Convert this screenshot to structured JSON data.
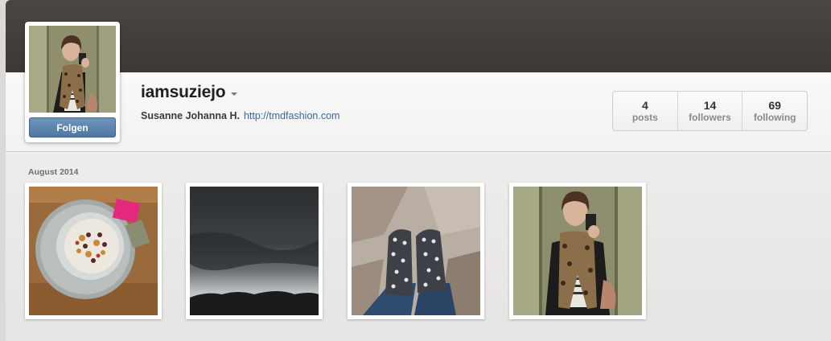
{
  "profile": {
    "username": "iamsuziejo",
    "full_name": "Susanne Johanna H.",
    "website": "http://tmdfashion.com",
    "follow_label": "Folgen"
  },
  "stats": [
    {
      "value": "4",
      "label": "posts"
    },
    {
      "value": "14",
      "label": "followers"
    },
    {
      "value": "69",
      "label": "following"
    }
  ],
  "feed": {
    "section_label": "August 2014",
    "photos": [
      {
        "subject": "muesli bowl on wooden table"
      },
      {
        "subject": "dark stormy clouds over hills"
      },
      {
        "subject": "polka dot rain boots on stone floor"
      },
      {
        "subject": "mirror selfie in elevator"
      }
    ]
  },
  "colors": {
    "cover": "#463f3d",
    "follow_button": "#5b82ac",
    "link": "#3b6a9a"
  }
}
